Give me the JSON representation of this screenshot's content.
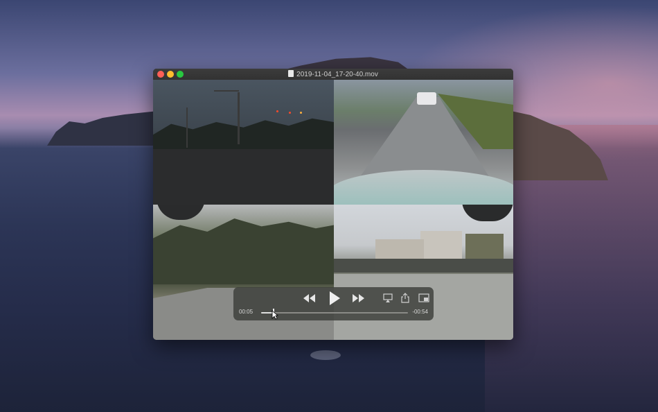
{
  "window": {
    "title": "2019-11-04_17-20-40.mov"
  },
  "playback": {
    "time_elapsed": "00:05",
    "time_remaining": "-00:54",
    "progress_fraction": 0.085
  },
  "icons": {
    "rewind": "rewind-icon",
    "play": "play-icon",
    "fast_forward": "fast-forward-icon",
    "airplay": "airplay-icon",
    "share": "share-icon",
    "pip": "picture-in-picture-icon"
  },
  "colors": {
    "close": "#fe5f57",
    "minimize": "#febc2e",
    "zoom": "#28c840"
  }
}
